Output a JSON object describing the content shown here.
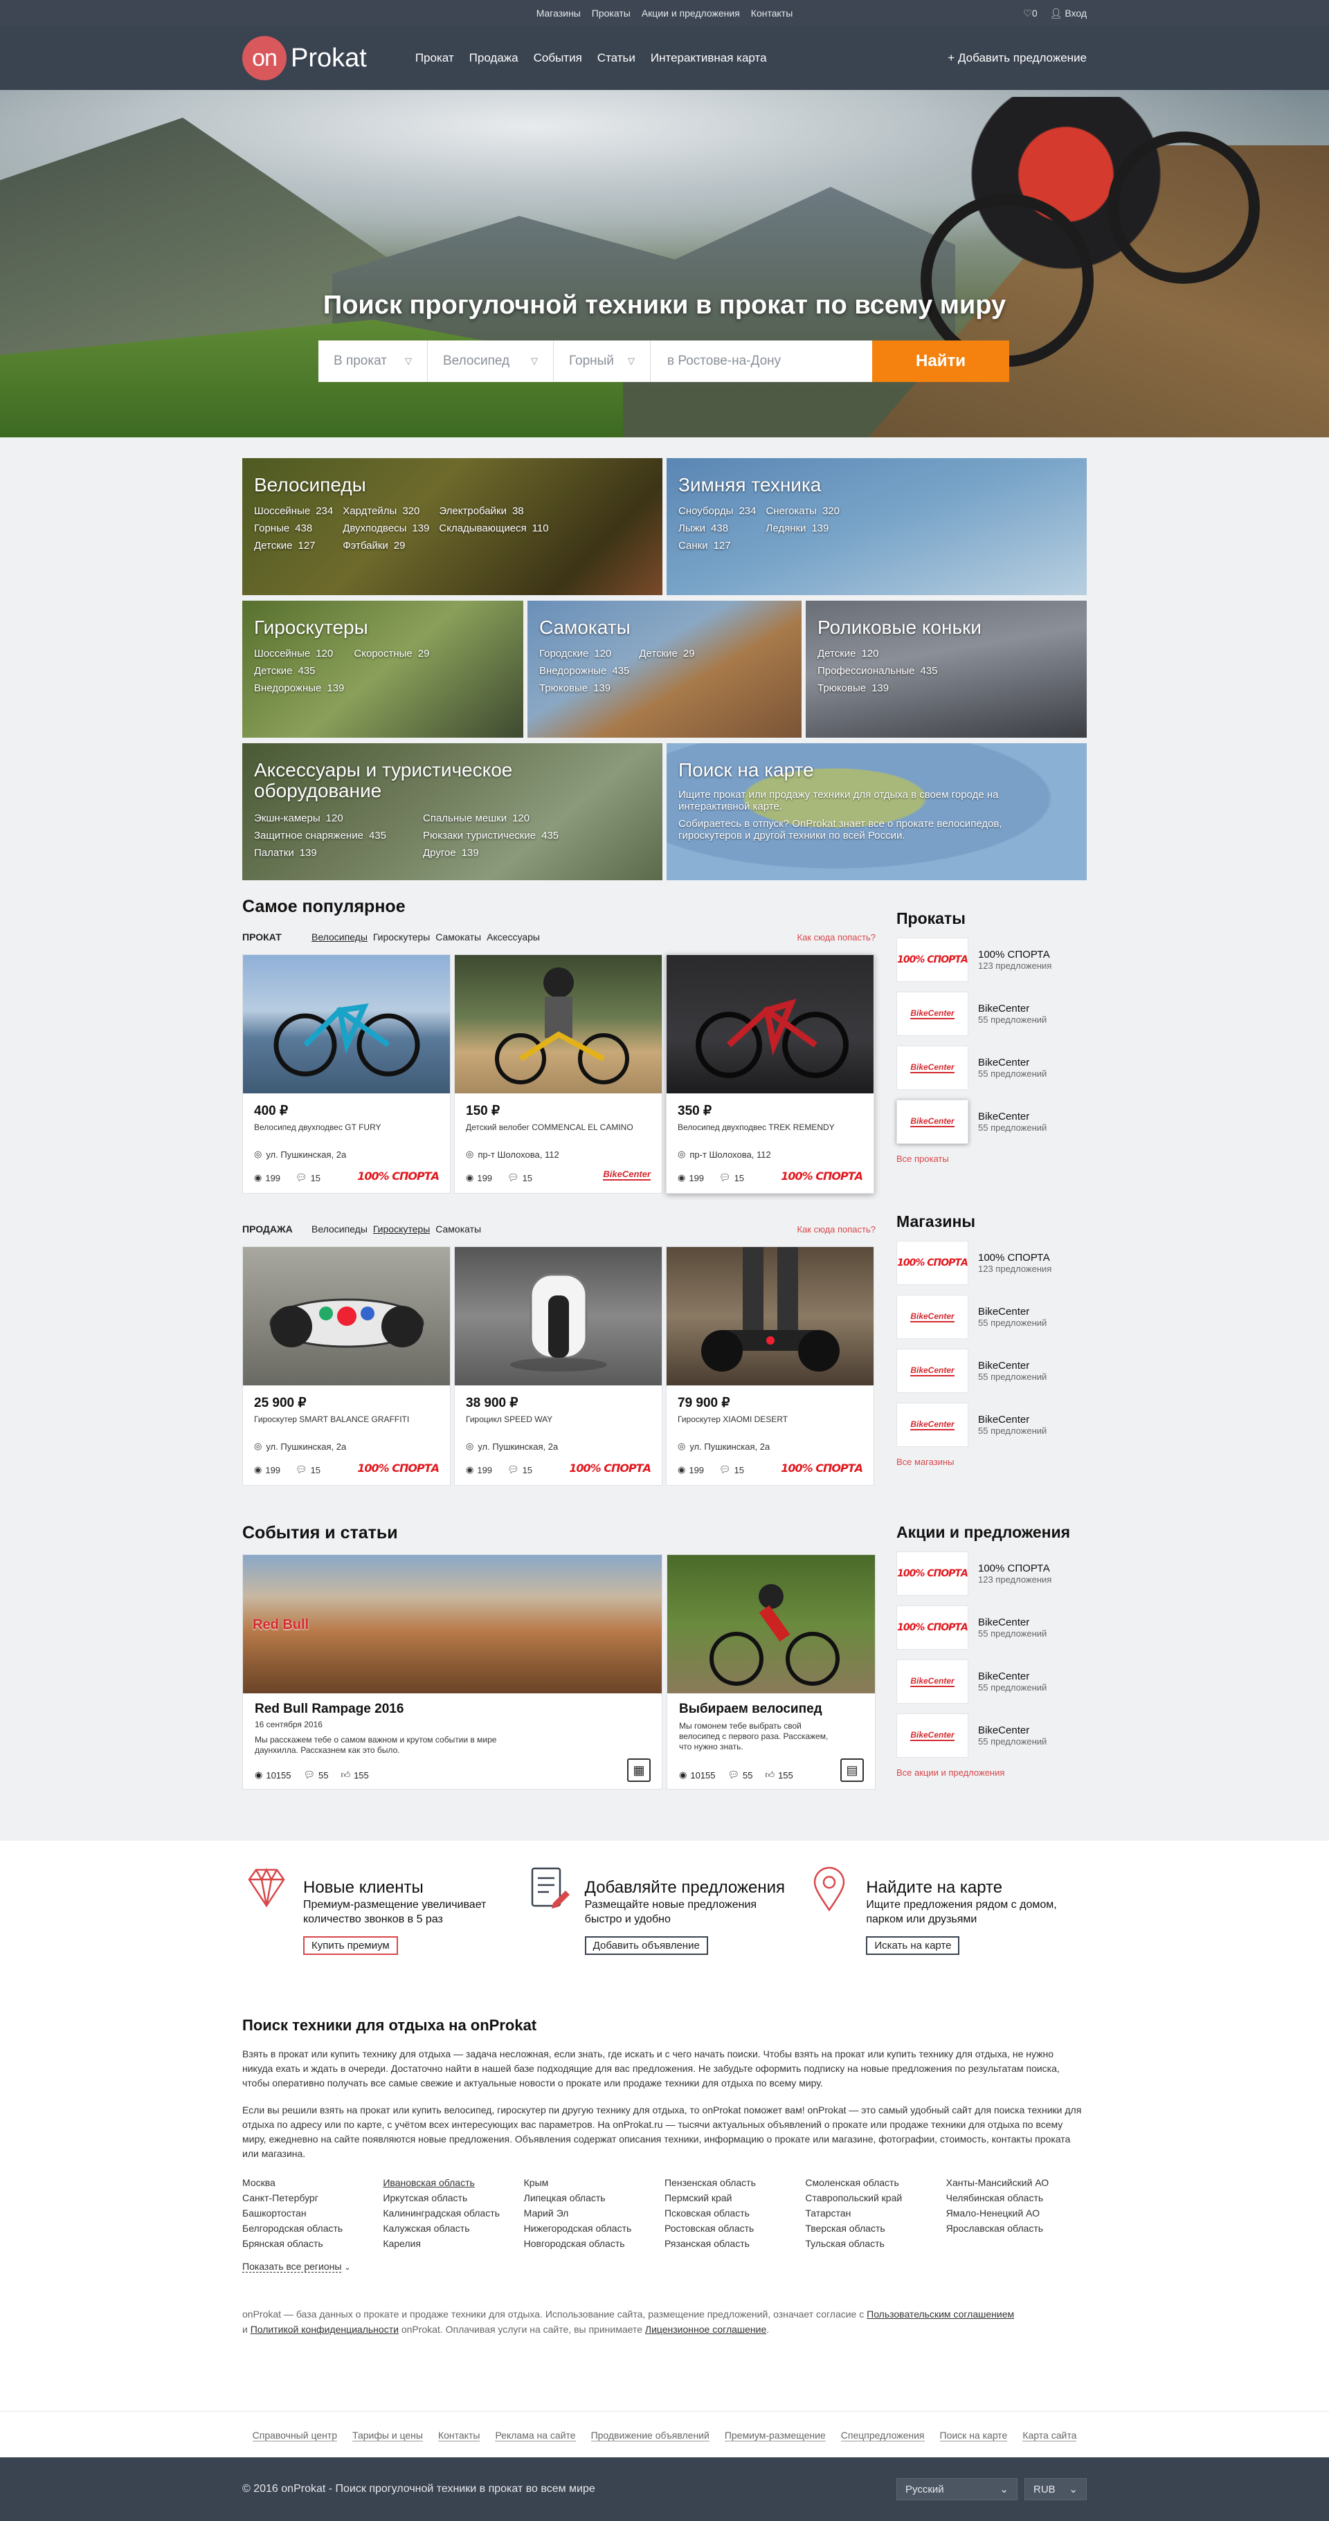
{
  "topbar": {
    "links": [
      "Магазины",
      "Прокаты",
      "Акции и предложения",
      "Контакты"
    ],
    "favorites_count": "0",
    "login": "Вход"
  },
  "header": {
    "logo_on": "on",
    "logo_word": "Prokat",
    "nav": [
      "Прокат",
      "Продажа",
      "События",
      "Статьи",
      "Интерактивная карта"
    ],
    "add_offer": "+ Добавить предложение"
  },
  "hero": {
    "title": "Поиск прогулочной техники в прокат по всему миру",
    "mode": "В прокат",
    "type": "Велосипед",
    "subtype": "Горный",
    "city_placeholder": "в Ростове-на-Дону",
    "button": "Найти"
  },
  "categories": [
    {
      "title": "Велосипеды",
      "items": [
        [
          "Шоссейные",
          "234"
        ],
        [
          "Хардтейлы",
          "320"
        ],
        [
          "Электробайки",
          "38"
        ],
        [
          "Горные",
          "438"
        ],
        [
          "Двухподвесы",
          "139"
        ],
        [
          "Складывающиеся",
          "110"
        ],
        [
          "Детские",
          "127"
        ],
        [
          "Фэтбайки",
          "29"
        ]
      ]
    },
    {
      "title": "Зимняя техника",
      "items": [
        [
          "Сноуборды",
          "234"
        ],
        [
          "Снегокаты",
          "320"
        ],
        [
          "Лыжи",
          "438"
        ],
        [
          "Ледянки",
          "139"
        ],
        [
          "Санки",
          "127"
        ]
      ]
    },
    {
      "title": "Гироскутеры",
      "items": [
        [
          "Шоссейные",
          "120"
        ],
        [
          "Скоростные",
          "29"
        ],
        [
          "Детские",
          "435"
        ],
        [
          "Внедорожные",
          "139"
        ]
      ]
    },
    {
      "title": "Самокаты",
      "items": [
        [
          "Городские",
          "120"
        ],
        [
          "Детские",
          "29"
        ],
        [
          "Внедорожные",
          "435"
        ],
        [
          "Трюковые",
          "139"
        ]
      ]
    },
    {
      "title": "Роликовые коньки",
      "items": [
        [
          "Детские",
          "120"
        ],
        [
          "Профессиональные",
          "435"
        ],
        [
          "Трюковые",
          "139"
        ]
      ]
    },
    {
      "title": "Аксессуары и туристическое оборудование",
      "items": [
        [
          "Экшн-камеры",
          "120"
        ],
        [
          "Спальные мешки",
          "120"
        ],
        [
          "Защитное снаряжение",
          "435"
        ],
        [
          "Рюкзаки туристические",
          "435"
        ],
        [
          "Палатки",
          "139"
        ],
        [
          "Другое",
          "139"
        ]
      ]
    },
    {
      "title": "Поиск на карте",
      "desc1": "Ищите прокат или продажу техники для отдыха в своем городе на интерактивной карте.",
      "desc2": "Собираетесь в отпуск? OnProkat знает все о прокате велосипедов, гироскутеров и другой техники по всей России."
    }
  ],
  "popular": {
    "title": "Самое популярное",
    "rent_label": "ПРОКАТ",
    "rent_tabs": [
      "Велосипеды",
      "Гироскутеры",
      "Самокаты",
      "Аксессуары"
    ],
    "how_to": "Как сюда попасть?",
    "rent_cards": [
      {
        "price": "400 ₽",
        "name": "Велосипед двухподвес GT FURY",
        "addr": "ул. Пушкинская, 2а",
        "views": "199",
        "comments": "15",
        "brand": "100% СПОРТА"
      },
      {
        "price": "150 ₽",
        "name": "Детский велобег COMMENCAL EL CAMINO",
        "addr": "пр-т Шолохова, 112",
        "views": "199",
        "comments": "15",
        "brand": "BikeCenter"
      },
      {
        "price": "350 ₽",
        "name": "Велосипед двухподвес TREK REMENDY",
        "addr": "пр-т Шолохова, 112",
        "views": "199",
        "comments": "15",
        "brand": "100% СПОРТА"
      }
    ],
    "sale_label": "ПРОДАЖА",
    "sale_tabs": [
      "Велосипеды",
      "Гироскутеры",
      "Самокаты"
    ],
    "sale_cards": [
      {
        "price": "25 900 ₽",
        "name": "Гироскутер SMART BALANCE GRAFFITI",
        "addr": "ул. Пушкинская, 2а",
        "views": "199",
        "comments": "15",
        "brand": "100% СПОРТА"
      },
      {
        "price": "38 900 ₽",
        "name": "Гироцикл SPEED WAY",
        "addr": "ул. Пушкинская, 2а",
        "views": "199",
        "comments": "15",
        "brand": "100% СПОРТА"
      },
      {
        "price": "79 900 ₽",
        "name": "Гироскутер XIAOMI DESERT",
        "addr": "ул. Пушкинская, 2а",
        "views": "199",
        "comments": "15",
        "brand": "100% СПОРТА"
      }
    ]
  },
  "sidebar": {
    "rentals_title": "Прокаты",
    "rentals": [
      {
        "name": "100% СПОРТА",
        "count": "123 предложения",
        "logo": "100% СПОРТА"
      },
      {
        "name": "BikeCenter",
        "count": "55 предложений",
        "logo": "BikeCenter"
      },
      {
        "name": "BikeCenter",
        "count": "55 предложений",
        "logo": "BikeCenter"
      },
      {
        "name": "BikeCenter",
        "count": "55 предложений",
        "logo": "BikeCenter"
      }
    ],
    "rentals_more": "Все прокаты",
    "shops_title": "Магазины",
    "shops": [
      {
        "name": "100% СПОРТА",
        "count": "123 предложения",
        "logo": "100% СПОРТА"
      },
      {
        "name": "BikeCenter",
        "count": "55 предложений",
        "logo": "BikeCenter"
      },
      {
        "name": "BikeCenter",
        "count": "55 предложений",
        "logo": "BikeCenter"
      },
      {
        "name": "BikeCenter",
        "count": "55 предложений",
        "logo": "BikeCenter"
      }
    ],
    "shops_more": "Все магазины",
    "promo_title": "Акции и предложения",
    "promos": [
      {
        "name": "100% СПОРТА",
        "count": "123 предложения",
        "logo": "100% СПОРТА"
      },
      {
        "name": "BikeCenter",
        "count": "55 предложений",
        "logo": "BikeCenter"
      },
      {
        "name": "BikeCenter",
        "count": "55 предложений",
        "logo": "BikeCenter"
      },
      {
        "name": "BikeCenter",
        "count": "55 предложений",
        "logo": "BikeCenter"
      }
    ],
    "promo_more": "Все акции и предложения"
  },
  "events": {
    "title": "События и статьи",
    "items": [
      {
        "title": "Red Bull Rampage 2016",
        "date": "16 сентября 2016",
        "text": "Мы расскажем тебе о самом важном и крутом событии в мире даунхилла. Рассказнем как это было.",
        "views": "10155",
        "comments": "55",
        "likes": "155",
        "logo": "Red Bull"
      },
      {
        "title": "Выбираем велосипед",
        "text": "Мы гомонем тебе выбрать свой велосипед с первого раза. Расскажем, что нужно знать.",
        "views": "10155",
        "comments": "55",
        "likes": "155"
      }
    ]
  },
  "features": [
    {
      "title": "Новые клиенты",
      "text": "Премиум-размещение увеличивает количество звонков в 5 раз",
      "button": "Купить премиум"
    },
    {
      "title": "Добавляйте предложения",
      "text": "Размещайте новые предложения быстро и удобно",
      "button": "Добавить объявление"
    },
    {
      "title": "Найдите на карте",
      "text": "Ищите предложения рядом с домом, парком или друзьями",
      "button": "Искать на карте"
    }
  ],
  "seo": {
    "title": "Поиск техники для отдыха на onProkat",
    "p1": "Взять в прокат или купить технику для отдыха — задача несложная, если знать, где искать и с чего начать поиски. Чтобы взять на прокат или купить технику для отдыха, не нужно никуда ехать и ждать в очереди. Достаточно найти в нашей базе подходящие для вас предложения. Не забудьте оформить подписку на новые предложения по результатам поиска, чтобы оперативно получать все самые свежие и актуальные новости о прокате или продаже техники для отдыха по всему миру.",
    "p2": "Если вы решили взять на прокат или купить велосипед, гироскутер пи другую технику для отдыха, то onProkat  поможет вам! onProkat  — это самый удобный сайт для поиска техники для отдыха по адресу или по карте, с учётом всех интересующих вас параметров. На onProkat.ru — тысячи актуальных объявлений о прокате или продаже техники для отдыха по всему миру, ежедневно на сайте появляются новые предложения. Объявления содержат описания техники, информацию о прокате или магазине, фотографии, стоимость, контакты проката или магазина.",
    "regions": [
      [
        "Москва",
        "Санкт-Петербург",
        "Башкортостан",
        "Белгородская область",
        "Брянская область"
      ],
      [
        "Ивановская область",
        "Иркутская область",
        "Калининградская область",
        "Калужская область",
        "Карелия"
      ],
      [
        "Крым",
        "Липецкая область",
        "Марий Эл",
        "Нижегородская область",
        "Новгородская область"
      ],
      [
        "Пензенская область",
        "Пермский край",
        "Псковская область",
        "Ростовская область",
        "Рязанская область"
      ],
      [
        "Смоленская область",
        "Ставропольский край",
        "Татарстан",
        "Тверская область",
        "Тульская область"
      ],
      [
        "Ханты-Мансийский АО",
        "Челябинская область",
        "Ямало-Ненецкий АО",
        "Ярославская область"
      ]
    ],
    "show_all": "Показать все регионы",
    "legal_a": "onProkat",
    "legal_b": " — база данных о прокате и продаже техники для отдыха. Использование сайта, размещение предложений, означает согласие с ",
    "legal_c": "Пользовательским соглашением",
    "legal_d": "и ",
    "legal_e": "Политикой конфиденциальности",
    "legal_f": " onProkat. Оплачивая услуги на сайте, вы принимаете ",
    "legal_g": "Лицензионное соглашение",
    "legal_h": "."
  },
  "footer_links": [
    "Справочный центр",
    "Тарифы и цены",
    "Контакты",
    "Реклама на сайте",
    "Продвижение объявлений",
    "Премиум-размещение",
    "Спецпредложения",
    "Поиск на карте",
    "Карта сайта"
  ],
  "bottom": {
    "copyright": "© 2016 onProkat - Поиск прогулочной техники в прокат во всем мире",
    "language": "Русский",
    "currency": "RUB"
  }
}
